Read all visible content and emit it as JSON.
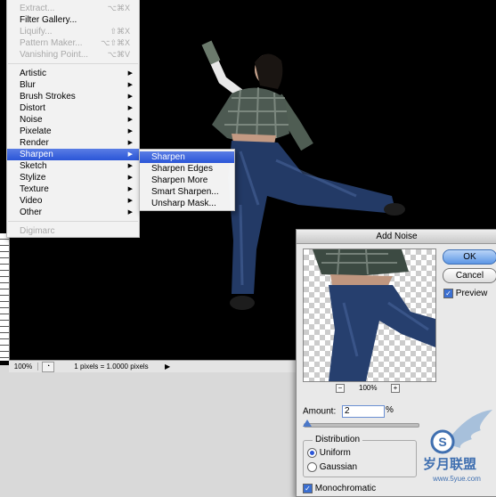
{
  "filter_menu": {
    "top_items": [
      {
        "label": "Extract...",
        "shortcut": "⌥⌘X",
        "enabled": false
      },
      {
        "label": "Filter Gallery...",
        "shortcut": "",
        "enabled": true
      },
      {
        "label": "Liquify...",
        "shortcut": "⇧⌘X",
        "enabled": false
      },
      {
        "label": "Pattern Maker...",
        "shortcut": "⌥⇧⌘X",
        "enabled": false
      },
      {
        "label": "Vanishing Point...",
        "shortcut": "⌥⌘V",
        "enabled": false
      }
    ],
    "categories": [
      "Artistic",
      "Blur",
      "Brush Strokes",
      "Distort",
      "Noise",
      "Pixelate",
      "Render",
      "Sharpen",
      "Sketch",
      "Stylize",
      "Texture",
      "Video",
      "Other"
    ],
    "selected_category": "Sharpen",
    "bottom_items": [
      {
        "label": "Digimarc",
        "enabled": false
      }
    ]
  },
  "sharpen_submenu": {
    "items": [
      "Sharpen",
      "Sharpen Edges",
      "Sharpen More",
      "Smart Sharpen...",
      "Unsharp Mask..."
    ],
    "highlighted": "Sharpen"
  },
  "status_bar": {
    "zoom": "100%",
    "info": "1 pixels = 1.0000 pixels"
  },
  "dialog": {
    "title": "Add Noise",
    "ok_label": "OK",
    "cancel_label": "Cancel",
    "preview_label": "Preview",
    "preview_checked": true,
    "zoom_minus": "−",
    "zoom_plus": "+",
    "zoom_level": "100%",
    "amount_label": "Amount:",
    "amount_value": "2",
    "amount_unit": "%",
    "amount_slider_fraction": 0.01,
    "distribution_label": "Distribution",
    "uniform_label": "Uniform",
    "gaussian_label": "Gaussian",
    "selected_distribution": "Uniform",
    "monochromatic_label": "Monochromatic",
    "monochromatic_checked": true
  },
  "watermark": {
    "text_cn": "岁月联盟",
    "url": "www.5yue.com",
    "logo_letter": "S"
  },
  "icons": {
    "submenu_arrow": "submenu-arrow-icon",
    "check": "checkmark-icon"
  },
  "colors": {
    "selection": "#2a55d7",
    "canvas": "#000000",
    "dialog_bg": "#e9e9e9"
  }
}
